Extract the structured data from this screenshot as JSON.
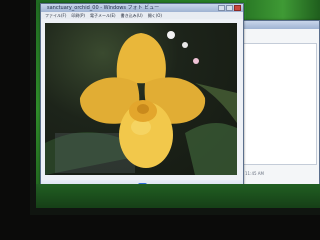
{
  "window": {
    "title": "sanctuary_orchid_00 - Windows フォト ビュー",
    "menus": [
      "ファイル(F)",
      "印刷(P)",
      "電子メール(E)",
      "書き込み(U)",
      "開く(O)"
    ]
  },
  "back_window": {
    "timestamp": "11:45 AM"
  },
  "colors": {
    "petal": "#e9b73a",
    "lip": "#f2c84b",
    "desktop": "#2f8f2a",
    "accent": "#2d6ad6"
  },
  "icons": [
    "prev-icon",
    "play-slideshow-icon",
    "next-icon",
    "rotate-icon",
    "delete-icon"
  ]
}
